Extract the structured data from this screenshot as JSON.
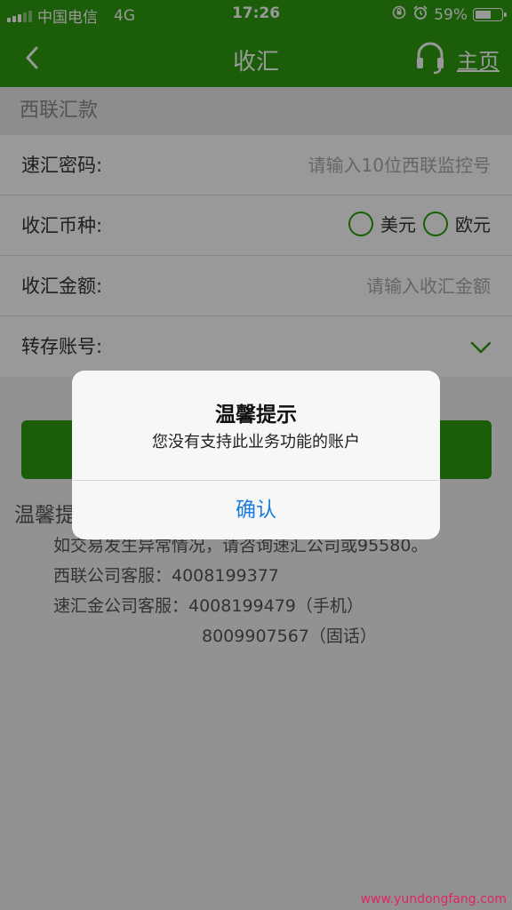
{
  "status_bar": {
    "carrier": "中国电信",
    "network": "4G",
    "time": "17:26",
    "battery": "59%",
    "battery_level": 0.59
  },
  "nav": {
    "title": "收汇",
    "home": "主页",
    "icons": [
      "back-chevron-icon",
      "headset-icon"
    ]
  },
  "section": {
    "title": "西联汇款"
  },
  "form": {
    "code_label": "速汇密码:",
    "code_placeholder": "请输入10位西联监控号",
    "currency_label": "收汇币种:",
    "currency_options": [
      "美元",
      "欧元"
    ],
    "amount_label": "收汇金额:",
    "amount_placeholder": "请输入收汇金额",
    "account_label": "转存账号:"
  },
  "tips": {
    "title": "温馨提",
    "line1": "如交易发生异常情况，请咨询速汇公司或95580。",
    "line2": "西联公司客服：4008199377",
    "line3": "速汇金公司客服：4008199479（手机）",
    "line4": "8009907567（固话）"
  },
  "dialog": {
    "title": "温馨提示",
    "message": "您没有支持此业务功能的账户",
    "confirm": "确认"
  },
  "watermark": "www.yundongfang.com",
  "colors": {
    "primary_green": "#2d9c0e",
    "dialog_button_blue": "#1a7de0"
  }
}
